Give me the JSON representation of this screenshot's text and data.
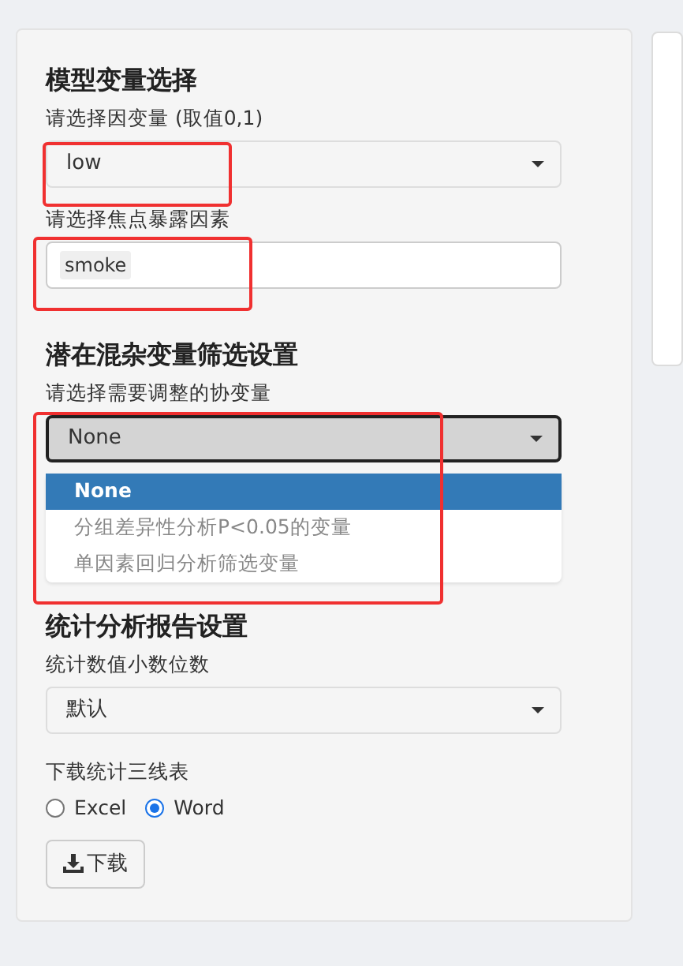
{
  "sections": [
    {
      "title": "模型变量选择",
      "fields": [
        {
          "kind": "select",
          "label": "请选择因变量 (取值0,1)",
          "value": "low",
          "focused": false
        },
        {
          "kind": "tags",
          "label": "请选择焦点暴露因素",
          "tags": [
            "smoke"
          ]
        }
      ]
    },
    {
      "title": "潜在混杂变量筛选设置",
      "fields": [
        {
          "kind": "select",
          "label": "请选择需要调整的协变量",
          "value": "None",
          "focused": true,
          "options": [
            {
              "label": "None",
              "selected": true
            },
            {
              "label": "分组差异性分析P<0.05的变量",
              "selected": false
            },
            {
              "label": "单因素回归分析筛选变量",
              "selected": false
            }
          ]
        }
      ]
    },
    {
      "title": "统计分析报告设置",
      "fields": [
        {
          "kind": "select",
          "label": "统计数值小数位数",
          "value": "默认",
          "focused": false
        },
        {
          "kind": "radio",
          "label": "下载统计三线表",
          "choices": [
            {
              "label": "Excel",
              "selected": false
            },
            {
              "label": "Word",
              "selected": true
            }
          ]
        },
        {
          "kind": "button",
          "label": "下载"
        }
      ]
    }
  ]
}
